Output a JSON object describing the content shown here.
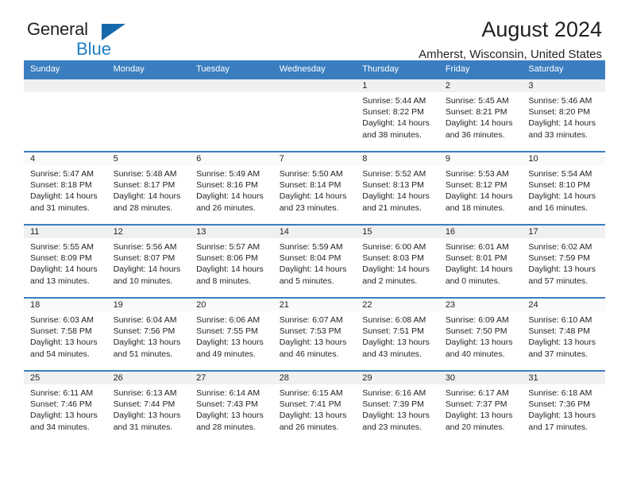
{
  "brand": {
    "name_part1": "General",
    "name_part2": "Blue",
    "triangle_color": "#1569ab",
    "blue_color": "#1f7ec2"
  },
  "header": {
    "title": "August 2024",
    "subtitle": "Amherst, Wisconsin, United States"
  },
  "theme": {
    "header_blue": "#3b7ec0",
    "row_border_blue": "#3b7ec0",
    "daynum_band_gray": "#f0f0f0",
    "text_color": "#231f20"
  },
  "weekdays": [
    "Sunday",
    "Monday",
    "Tuesday",
    "Wednesday",
    "Thursday",
    "Friday",
    "Saturday"
  ],
  "labels": {
    "sunrise_prefix": "Sunrise:",
    "sunset_prefix": "Sunset:",
    "daylight_prefix": "Daylight:"
  },
  "weeks": [
    [
      {
        "day": "",
        "sunrise": "",
        "sunset": "",
        "daylight_line1": "",
        "daylight_line2": ""
      },
      {
        "day": "",
        "sunrise": "",
        "sunset": "",
        "daylight_line1": "",
        "daylight_line2": ""
      },
      {
        "day": "",
        "sunrise": "",
        "sunset": "",
        "daylight_line1": "",
        "daylight_line2": ""
      },
      {
        "day": "",
        "sunrise": "",
        "sunset": "",
        "daylight_line1": "",
        "daylight_line2": ""
      },
      {
        "day": "1",
        "sunrise": "Sunrise: 5:44 AM",
        "sunset": "Sunset: 8:22 PM",
        "daylight_line1": "Daylight: 14 hours",
        "daylight_line2": "and 38 minutes."
      },
      {
        "day": "2",
        "sunrise": "Sunrise: 5:45 AM",
        "sunset": "Sunset: 8:21 PM",
        "daylight_line1": "Daylight: 14 hours",
        "daylight_line2": "and 36 minutes."
      },
      {
        "day": "3",
        "sunrise": "Sunrise: 5:46 AM",
        "sunset": "Sunset: 8:20 PM",
        "daylight_line1": "Daylight: 14 hours",
        "daylight_line2": "and 33 minutes."
      }
    ],
    [
      {
        "day": "4",
        "sunrise": "Sunrise: 5:47 AM",
        "sunset": "Sunset: 8:18 PM",
        "daylight_line1": "Daylight: 14 hours",
        "daylight_line2": "and 31 minutes."
      },
      {
        "day": "5",
        "sunrise": "Sunrise: 5:48 AM",
        "sunset": "Sunset: 8:17 PM",
        "daylight_line1": "Daylight: 14 hours",
        "daylight_line2": "and 28 minutes."
      },
      {
        "day": "6",
        "sunrise": "Sunrise: 5:49 AM",
        "sunset": "Sunset: 8:16 PM",
        "daylight_line1": "Daylight: 14 hours",
        "daylight_line2": "and 26 minutes."
      },
      {
        "day": "7",
        "sunrise": "Sunrise: 5:50 AM",
        "sunset": "Sunset: 8:14 PM",
        "daylight_line1": "Daylight: 14 hours",
        "daylight_line2": "and 23 minutes."
      },
      {
        "day": "8",
        "sunrise": "Sunrise: 5:52 AM",
        "sunset": "Sunset: 8:13 PM",
        "daylight_line1": "Daylight: 14 hours",
        "daylight_line2": "and 21 minutes."
      },
      {
        "day": "9",
        "sunrise": "Sunrise: 5:53 AM",
        "sunset": "Sunset: 8:12 PM",
        "daylight_line1": "Daylight: 14 hours",
        "daylight_line2": "and 18 minutes."
      },
      {
        "day": "10",
        "sunrise": "Sunrise: 5:54 AM",
        "sunset": "Sunset: 8:10 PM",
        "daylight_line1": "Daylight: 14 hours",
        "daylight_line2": "and 16 minutes."
      }
    ],
    [
      {
        "day": "11",
        "sunrise": "Sunrise: 5:55 AM",
        "sunset": "Sunset: 8:09 PM",
        "daylight_line1": "Daylight: 14 hours",
        "daylight_line2": "and 13 minutes."
      },
      {
        "day": "12",
        "sunrise": "Sunrise: 5:56 AM",
        "sunset": "Sunset: 8:07 PM",
        "daylight_line1": "Daylight: 14 hours",
        "daylight_line2": "and 10 minutes."
      },
      {
        "day": "13",
        "sunrise": "Sunrise: 5:57 AM",
        "sunset": "Sunset: 8:06 PM",
        "daylight_line1": "Daylight: 14 hours",
        "daylight_line2": "and 8 minutes."
      },
      {
        "day": "14",
        "sunrise": "Sunrise: 5:59 AM",
        "sunset": "Sunset: 8:04 PM",
        "daylight_line1": "Daylight: 14 hours",
        "daylight_line2": "and 5 minutes."
      },
      {
        "day": "15",
        "sunrise": "Sunrise: 6:00 AM",
        "sunset": "Sunset: 8:03 PM",
        "daylight_line1": "Daylight: 14 hours",
        "daylight_line2": "and 2 minutes."
      },
      {
        "day": "16",
        "sunrise": "Sunrise: 6:01 AM",
        "sunset": "Sunset: 8:01 PM",
        "daylight_line1": "Daylight: 14 hours",
        "daylight_line2": "and 0 minutes."
      },
      {
        "day": "17",
        "sunrise": "Sunrise: 6:02 AM",
        "sunset": "Sunset: 7:59 PM",
        "daylight_line1": "Daylight: 13 hours",
        "daylight_line2": "and 57 minutes."
      }
    ],
    [
      {
        "day": "18",
        "sunrise": "Sunrise: 6:03 AM",
        "sunset": "Sunset: 7:58 PM",
        "daylight_line1": "Daylight: 13 hours",
        "daylight_line2": "and 54 minutes."
      },
      {
        "day": "19",
        "sunrise": "Sunrise: 6:04 AM",
        "sunset": "Sunset: 7:56 PM",
        "daylight_line1": "Daylight: 13 hours",
        "daylight_line2": "and 51 minutes."
      },
      {
        "day": "20",
        "sunrise": "Sunrise: 6:06 AM",
        "sunset": "Sunset: 7:55 PM",
        "daylight_line1": "Daylight: 13 hours",
        "daylight_line2": "and 49 minutes."
      },
      {
        "day": "21",
        "sunrise": "Sunrise: 6:07 AM",
        "sunset": "Sunset: 7:53 PM",
        "daylight_line1": "Daylight: 13 hours",
        "daylight_line2": "and 46 minutes."
      },
      {
        "day": "22",
        "sunrise": "Sunrise: 6:08 AM",
        "sunset": "Sunset: 7:51 PM",
        "daylight_line1": "Daylight: 13 hours",
        "daylight_line2": "and 43 minutes."
      },
      {
        "day": "23",
        "sunrise": "Sunrise: 6:09 AM",
        "sunset": "Sunset: 7:50 PM",
        "daylight_line1": "Daylight: 13 hours",
        "daylight_line2": "and 40 minutes."
      },
      {
        "day": "24",
        "sunrise": "Sunrise: 6:10 AM",
        "sunset": "Sunset: 7:48 PM",
        "daylight_line1": "Daylight: 13 hours",
        "daylight_line2": "and 37 minutes."
      }
    ],
    [
      {
        "day": "25",
        "sunrise": "Sunrise: 6:11 AM",
        "sunset": "Sunset: 7:46 PM",
        "daylight_line1": "Daylight: 13 hours",
        "daylight_line2": "and 34 minutes."
      },
      {
        "day": "26",
        "sunrise": "Sunrise: 6:13 AM",
        "sunset": "Sunset: 7:44 PM",
        "daylight_line1": "Daylight: 13 hours",
        "daylight_line2": "and 31 minutes."
      },
      {
        "day": "27",
        "sunrise": "Sunrise: 6:14 AM",
        "sunset": "Sunset: 7:43 PM",
        "daylight_line1": "Daylight: 13 hours",
        "daylight_line2": "and 28 minutes."
      },
      {
        "day": "28",
        "sunrise": "Sunrise: 6:15 AM",
        "sunset": "Sunset: 7:41 PM",
        "daylight_line1": "Daylight: 13 hours",
        "daylight_line2": "and 26 minutes."
      },
      {
        "day": "29",
        "sunrise": "Sunrise: 6:16 AM",
        "sunset": "Sunset: 7:39 PM",
        "daylight_line1": "Daylight: 13 hours",
        "daylight_line2": "and 23 minutes."
      },
      {
        "day": "30",
        "sunrise": "Sunrise: 6:17 AM",
        "sunset": "Sunset: 7:37 PM",
        "daylight_line1": "Daylight: 13 hours",
        "daylight_line2": "and 20 minutes."
      },
      {
        "day": "31",
        "sunrise": "Sunrise: 6:18 AM",
        "sunset": "Sunset: 7:36 PM",
        "daylight_line1": "Daylight: 13 hours",
        "daylight_line2": "and 17 minutes."
      }
    ]
  ]
}
